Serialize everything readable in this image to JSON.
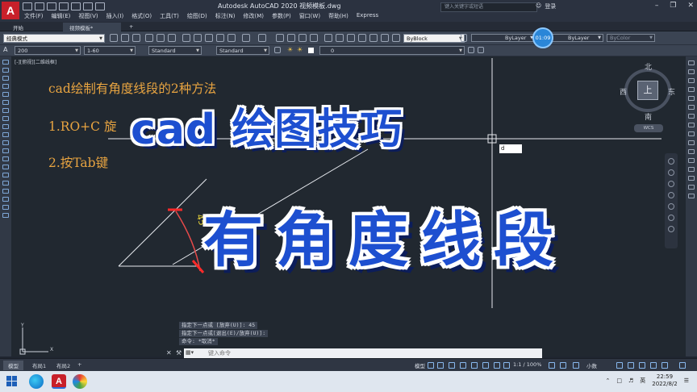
{
  "app": {
    "logo": "A",
    "window_title": "Autodesk AutoCAD 2020    视频模板.dwg",
    "search_placeholder": "键入关键字或短语",
    "login_label": "登录"
  },
  "menu": [
    "文件(F)",
    "编辑(E)",
    "视图(V)",
    "插入(I)",
    "格式(O)",
    "工具(T)",
    "绘图(D)",
    "标注(N)",
    "修改(M)",
    "参数(P)",
    "窗口(W)",
    "帮助(H)",
    "Express"
  ],
  "tabs": {
    "start": "开始",
    "drawing": "视频模板*",
    "add": "+"
  },
  "toolbar": {
    "workspace": "经典模式",
    "layer_by_block": "ByBlock",
    "linetype": "ByLayer",
    "lineweight": "ByLayer",
    "plot_style": "ByColor",
    "clock_badge": "01:09"
  },
  "toolbar2": {
    "scale_combo": "200",
    "dim_combo": "1-60",
    "text_style": "Standard",
    "dim_style": "Standard",
    "layer_value": "0"
  },
  "viewport": {
    "label": "[-][俯视][二维线框]"
  },
  "canvas_text": {
    "heading": "cad绘制有角度线段的2种方法",
    "method1": "1.RO+C 旋",
    "method2": "2.按Tab键",
    "dimension": "45",
    "coord_input": "d"
  },
  "overlay": {
    "title": "cad 绘图技巧",
    "subtitle": "有角度线段"
  },
  "viewcube": {
    "north": "北",
    "south": "南",
    "east": "东",
    "west": "西",
    "top": "上",
    "wcs": "WCS"
  },
  "command": {
    "history": [
      "指定下一点或 [放弃(U)]: 45",
      "指定下一点或[退出(E)/放弃(U)]:",
      "命令: *取消*"
    ],
    "placeholder": "键入命令"
  },
  "ucs": {
    "x": "X",
    "y": "Y"
  },
  "layout_tabs": {
    "model": "模型",
    "layout1": "布局1",
    "layout2": "布局2",
    "add": "+"
  },
  "status": {
    "model_label": "模型",
    "scale": "1:1 / 100%",
    "units": "小数"
  },
  "taskbar": {
    "ime": "英",
    "time": "22:59",
    "date": "2022/8/2"
  }
}
